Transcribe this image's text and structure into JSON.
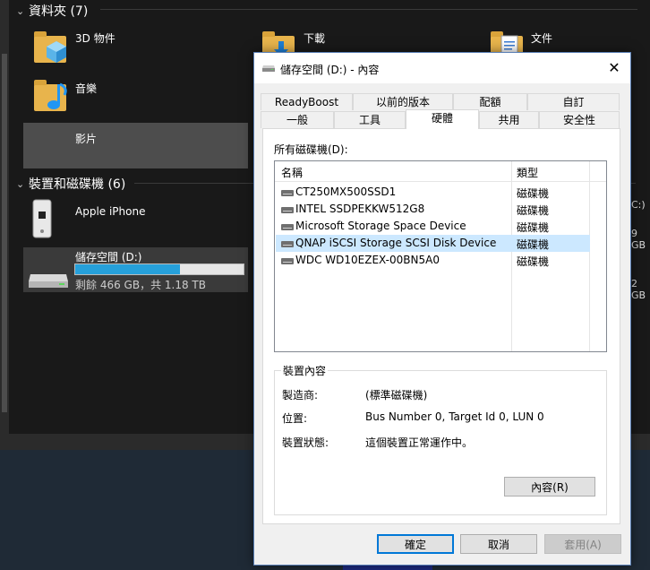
{
  "explorer": {
    "folders_header": "資料夾 (7)",
    "folders": [
      {
        "name": "3D 物件",
        "icon": "3d-objects-folder-icon"
      },
      {
        "name": "下載",
        "icon": "downloads-folder-icon"
      },
      {
        "name": "文件",
        "icon": "documents-folder-icon"
      },
      {
        "name": "音樂",
        "icon": "music-folder-icon"
      },
      {
        "name": "影片",
        "icon": "videos-folder-icon"
      }
    ],
    "devices_header": "裝置和磁碟機 (6)",
    "devices": [
      {
        "name": "Apple iPhone",
        "icon": "iphone-device-icon"
      },
      {
        "name": "儲存空間 (D:)",
        "icon": "hard-drive-icon",
        "free_text": "剩餘 466 GB，共 1.18 TB",
        "used_fraction": 0.62
      }
    ],
    "right_fragments": [
      "C:)",
      "9 GB",
      "2 GB"
    ]
  },
  "dialog": {
    "title": "儲存空間 (D:) - 內容",
    "close_label": "✕",
    "tabs_row1": [
      "ReadyBoost",
      "以前的版本",
      "配額",
      "自訂"
    ],
    "tabs_row2": [
      "一般",
      "工具",
      "硬體",
      "共用",
      "安全性"
    ],
    "active_tab": "硬體",
    "all_disks_label": "所有磁碟機(D):",
    "columns": [
      "名稱",
      "類型"
    ],
    "disks": [
      {
        "name": "CT250MX500SSD1",
        "type": "磁碟機"
      },
      {
        "name": "INTEL SSDPEKKW512G8",
        "type": "磁碟機"
      },
      {
        "name": "Microsoft Storage Space Device",
        "type": "磁碟機"
      },
      {
        "name": "QNAP iSCSI Storage SCSI Disk Device",
        "type": "磁碟機"
      },
      {
        "name": "WDC WD10EZEX-00BN5A0",
        "type": "磁碟機"
      }
    ],
    "selected_disk_index": 3,
    "group_title": "裝置內容",
    "props": [
      {
        "label": "製造商:",
        "value": "(標準磁碟機)"
      },
      {
        "label": "位置:",
        "value": "Bus Number 0, Target Id 0, LUN 0"
      },
      {
        "label": "裝置狀態:",
        "value": "這個裝置正常運作中。"
      }
    ],
    "properties_button": "內容(R)",
    "ok_button": "確定",
    "cancel_button": "取消",
    "apply_button": "套用(A)",
    "colors": {
      "accent": "#0078d7",
      "selection": "#cce8ff",
      "progress": "#26a0da"
    }
  }
}
